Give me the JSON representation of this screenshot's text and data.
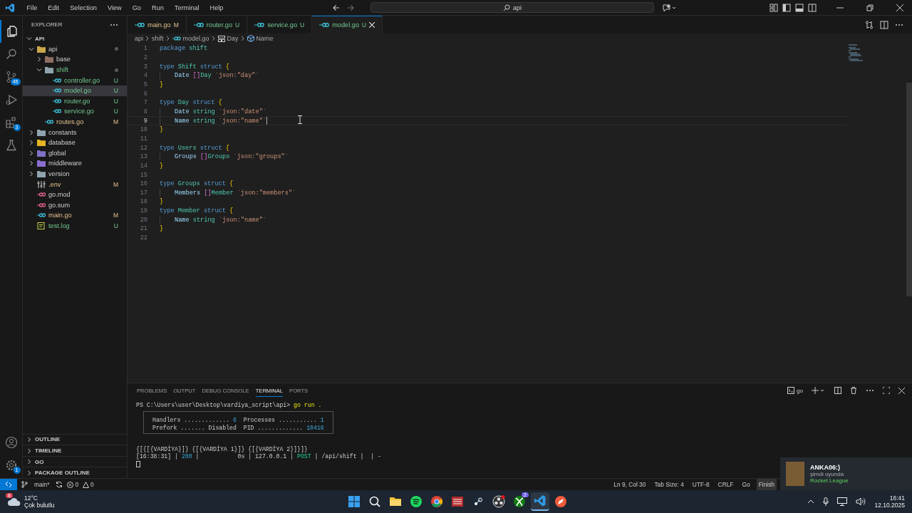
{
  "menu": [
    "File",
    "Edit",
    "Selection",
    "View",
    "Go",
    "Run",
    "Terminal",
    "Help"
  ],
  "command_center": {
    "value": "api"
  },
  "activity_bar": [
    {
      "kind": "explorer",
      "selected": true
    },
    {
      "kind": "search",
      "selected": false
    },
    {
      "kind": "source-control",
      "selected": false,
      "badge": "45"
    },
    {
      "kind": "run",
      "selected": false
    },
    {
      "kind": "extensions",
      "selected": false,
      "badge": "3"
    },
    {
      "kind": "testing",
      "selected": false
    }
  ],
  "activity_bottom": [
    {
      "kind": "account"
    },
    {
      "kind": "settings",
      "badge": "1"
    }
  ],
  "sidebar": {
    "title": "EXPLORER",
    "section": "API",
    "tree": [
      {
        "name": "api",
        "kind": "folder",
        "color": "#c9a74a",
        "expanded": true,
        "dot": true,
        "untracked": false,
        "modified": false,
        "children": [
          {
            "name": "base",
            "kind": "folder",
            "color": "#8d6e63",
            "expanded": false,
            "dot": false,
            "untracked": false,
            "modified": false
          },
          {
            "name": "shift",
            "kind": "folder",
            "color": "#90a4ae",
            "expanded": true,
            "dot": true,
            "untracked": true,
            "modified": false,
            "children": [
              {
                "name": "controller.go",
                "kind": "go",
                "untracked": true,
                "modified": false,
                "badge": "U",
                "selected": false
              },
              {
                "name": "model.go",
                "kind": "go",
                "untracked": true,
                "modified": false,
                "badge": "U",
                "selected": true
              },
              {
                "name": "router.go",
                "kind": "go",
                "untracked": true,
                "modified": false,
                "badge": "U",
                "selected": false
              },
              {
                "name": "service.go",
                "kind": "go",
                "untracked": true,
                "modified": false,
                "badge": "U",
                "selected": false
              }
            ]
          },
          {
            "name": "routes.go",
            "kind": "go",
            "untracked": false,
            "modified": true,
            "badge": "M",
            "selected": false
          }
        ]
      },
      {
        "name": "constants",
        "kind": "folder",
        "color": "#90a4ae",
        "expanded": false,
        "dot": false,
        "untracked": false,
        "modified": false
      },
      {
        "name": "database",
        "kind": "folder",
        "color": "#e6b422",
        "expanded": false,
        "dot": false,
        "untracked": false,
        "modified": false
      },
      {
        "name": "global",
        "kind": "folder",
        "color": "#7e72c9",
        "expanded": false,
        "dot": false,
        "untracked": false,
        "modified": false
      },
      {
        "name": "middleware",
        "kind": "folder",
        "color": "#8c6fd1",
        "expanded": false,
        "dot": false,
        "untracked": false,
        "modified": false
      },
      {
        "name": "version",
        "kind": "folder",
        "color": "#90a4ae",
        "expanded": false,
        "dot": false,
        "untracked": false,
        "modified": false
      },
      {
        "name": ".env",
        "kind": "env",
        "untracked": false,
        "modified": true,
        "badge": "M",
        "selected": false
      },
      {
        "name": "go.mod",
        "kind": "gomod",
        "untracked": false,
        "modified": false,
        "selected": false
      },
      {
        "name": "go.sum",
        "kind": "gomod",
        "untracked": false,
        "modified": false,
        "selected": false
      },
      {
        "name": "main.go",
        "kind": "go",
        "untracked": false,
        "modified": true,
        "badge": "M",
        "selected": false
      },
      {
        "name": "test.log",
        "kind": "log",
        "untracked": true,
        "modified": false,
        "badge": "U",
        "selected": false
      }
    ],
    "sections": [
      "OUTLINE",
      "TIMELINE",
      "GO",
      "PACKAGE OUTLINE"
    ]
  },
  "tabs": [
    {
      "label": "main.go",
      "badge": "M",
      "untracked": false,
      "modified": true,
      "selected": false
    },
    {
      "label": "router.go",
      "badge": "U",
      "untracked": true,
      "modified": false,
      "selected": false
    },
    {
      "label": "service.go",
      "badge": "U",
      "untracked": true,
      "modified": false,
      "selected": false
    },
    {
      "label": "model.go",
      "badge": "U",
      "untracked": true,
      "modified": false,
      "selected": true
    }
  ],
  "breadcrumbs": [
    {
      "label": "api",
      "kind": "folder"
    },
    {
      "label": "shift",
      "kind": "folder"
    },
    {
      "label": "model.go",
      "kind": "go"
    },
    {
      "label": "Day",
      "kind": "struct"
    },
    {
      "label": "Name",
      "kind": "field"
    }
  ],
  "code": [
    {
      "n": "1",
      "active": false,
      "tokens": [
        {
          "t": "package ",
          "kind": "kw"
        },
        {
          "t": "shift",
          "kind": "type"
        }
      ]
    },
    {
      "n": "2",
      "active": false
    },
    {
      "n": "3",
      "active": false,
      "tokens": [
        {
          "t": "type ",
          "kind": "kw"
        },
        {
          "t": "Shift",
          "kind": "type"
        },
        {
          "t": " struct ",
          "kind": "kw"
        },
        {
          "t": "{",
          "kind": "b1"
        }
      ]
    },
    {
      "n": "4",
      "active": false,
      "indent": true,
      "tokens": [
        {
          "t": "Date ",
          "kind": "field"
        },
        {
          "t": "[]",
          "kind": "b2"
        },
        {
          "t": "Day ",
          "kind": "type"
        },
        {
          "t": "`json:\"day\"`",
          "kind": "str"
        }
      ]
    },
    {
      "n": "5",
      "active": false,
      "tokens": [
        {
          "t": "}",
          "kind": "b1"
        }
      ]
    },
    {
      "n": "6",
      "active": false
    },
    {
      "n": "7",
      "active": false,
      "tokens": [
        {
          "t": "type ",
          "kind": "kw"
        },
        {
          "t": "Day",
          "kind": "type"
        },
        {
          "t": " struct ",
          "kind": "kw"
        },
        {
          "t": "{",
          "kind": "b1"
        }
      ]
    },
    {
      "n": "8",
      "active": false,
      "indent": true,
      "tokens": [
        {
          "t": "Date ",
          "kind": "field"
        },
        {
          "t": "string ",
          "kind": "type"
        },
        {
          "t": "`json:\"date\"`",
          "kind": "str"
        }
      ]
    },
    {
      "n": "9",
      "active": true,
      "indent": true,
      "tokens": [
        {
          "t": "Name ",
          "kind": "field"
        },
        {
          "t": "string ",
          "kind": "type"
        },
        {
          "t": "`json:\"name\"`",
          "kind": "str"
        }
      ]
    },
    {
      "n": "10",
      "active": false,
      "tokens": [
        {
          "t": "}",
          "kind": "b1"
        }
      ]
    },
    {
      "n": "11",
      "active": false
    },
    {
      "n": "12",
      "active": false,
      "tokens": [
        {
          "t": "type ",
          "kind": "kw"
        },
        {
          "t": "Users",
          "kind": "type"
        },
        {
          "t": " struct ",
          "kind": "kw"
        },
        {
          "t": "{",
          "kind": "b1"
        }
      ]
    },
    {
      "n": "13",
      "active": false,
      "indent": true,
      "tokens": [
        {
          "t": "Groups ",
          "kind": "field"
        },
        {
          "t": "[]",
          "kind": "b2"
        },
        {
          "t": "Groups ",
          "kind": "type"
        },
        {
          "t": "`json:\"groups\"`",
          "kind": "str"
        }
      ]
    },
    {
      "n": "14",
      "active": false,
      "tokens": [
        {
          "t": "}",
          "kind": "b1"
        }
      ]
    },
    {
      "n": "15",
      "active": false
    },
    {
      "n": "16",
      "active": false,
      "tokens": [
        {
          "t": "type ",
          "kind": "kw"
        },
        {
          "t": "Groups",
          "kind": "type"
        },
        {
          "t": " struct ",
          "kind": "kw"
        },
        {
          "t": "{",
          "kind": "b1"
        }
      ]
    },
    {
      "n": "17",
      "active": false,
      "indent": true,
      "tokens": [
        {
          "t": "Members ",
          "kind": "field"
        },
        {
          "t": "[]",
          "kind": "b2"
        },
        {
          "t": "Member ",
          "kind": "type"
        },
        {
          "t": "`json:\"members\"`",
          "kind": "str"
        }
      ]
    },
    {
      "n": "18",
      "active": false,
      "tokens": [
        {
          "t": "}",
          "kind": "b1"
        }
      ]
    },
    {
      "n": "19",
      "active": false,
      "tokens": [
        {
          "t": "type ",
          "kind": "kw"
        },
        {
          "t": "Member",
          "kind": "type"
        },
        {
          "t": " struct ",
          "kind": "kw"
        },
        {
          "t": "{",
          "kind": "b1"
        }
      ]
    },
    {
      "n": "20",
      "active": false,
      "indent": true,
      "tokens": [
        {
          "t": "Name ",
          "kind": "field"
        },
        {
          "t": "string ",
          "kind": "type"
        },
        {
          "t": "`json:\"name\"`",
          "kind": "str"
        }
      ]
    },
    {
      "n": "21",
      "active": false,
      "tokens": [
        {
          "t": "}",
          "kind": "b1"
        }
      ]
    },
    {
      "n": "22",
      "active": false
    }
  ],
  "panel": {
    "tabs": [
      {
        "label": "PROBLEMS",
        "selected": false
      },
      {
        "label": "OUTPUT",
        "selected": false
      },
      {
        "label": "DEBUG CONSOLE",
        "selected": false
      },
      {
        "label": "TERMINAL",
        "selected": true
      },
      {
        "label": "PORTS",
        "selected": false
      }
    ],
    "shell": "go",
    "prompt": "PS C:\\Users\\user\\Desktop\\vardiya_script\\api>",
    "command": "go run .",
    "info_box": [
      [
        {
          "t": "Handlers ............. ",
          "kind": "plain"
        },
        {
          "t": "6",
          "kind": "num"
        },
        {
          "t": "  Processes ........... ",
          "kind": "plain"
        },
        {
          "t": "1",
          "kind": "num"
        }
      ],
      [
        {
          "t": "Prefork ....... Disabled  PID ............. ",
          "kind": "plain"
        },
        {
          "t": "10416",
          "kind": "num"
        }
      ]
    ],
    "output": [
      [
        {
          "t": "{[{[{VARDİYA}]} {[{VARDİYA 1}]} {[{VARDİYA 2}]}]}",
          "kind": "plain"
        }
      ],
      [
        {
          "t": "[16:38:31] | ",
          "kind": "plain"
        },
        {
          "t": "200",
          "kind": "num"
        },
        {
          "t": " |           0s | 127.0.0.1 | ",
          "kind": "plain"
        },
        {
          "t": "POST",
          "kind": "ok"
        },
        {
          "t": " | /api/shift |  | -",
          "kind": "plain"
        }
      ]
    ]
  },
  "status_bar": {
    "branch": "main*",
    "errors": "0",
    "warnings": "0",
    "right": [
      "Ln 9, Col 30",
      "Tab Size: 4",
      "UTF-8",
      "CRLF",
      "Go",
      "Finish"
    ]
  },
  "notification": {
    "title": "ANKA06:)",
    "subtitle": "şimdi oyunda",
    "game": "Rocket League"
  },
  "taskbar": {
    "weather": {
      "temp": "12°C",
      "text": "Çok bulutlu",
      "badge": "8"
    },
    "apps": [
      {
        "kind": "start",
        "active": false
      },
      {
        "kind": "search",
        "active": false
      },
      {
        "kind": "folder",
        "active": false
      },
      {
        "kind": "spotify",
        "active": false
      },
      {
        "kind": "chrome",
        "active": false
      },
      {
        "kind": "mixer",
        "active": false
      },
      {
        "kind": "steam",
        "active": false
      },
      {
        "kind": "obs",
        "active": false,
        "dot": true
      },
      {
        "kind": "xbox",
        "active": false,
        "badge": "2"
      },
      {
        "kind": "vscode",
        "active": true
      },
      {
        "kind": "compass",
        "active": false
      }
    ],
    "time": "16:41",
    "date": "12.10.2025"
  }
}
